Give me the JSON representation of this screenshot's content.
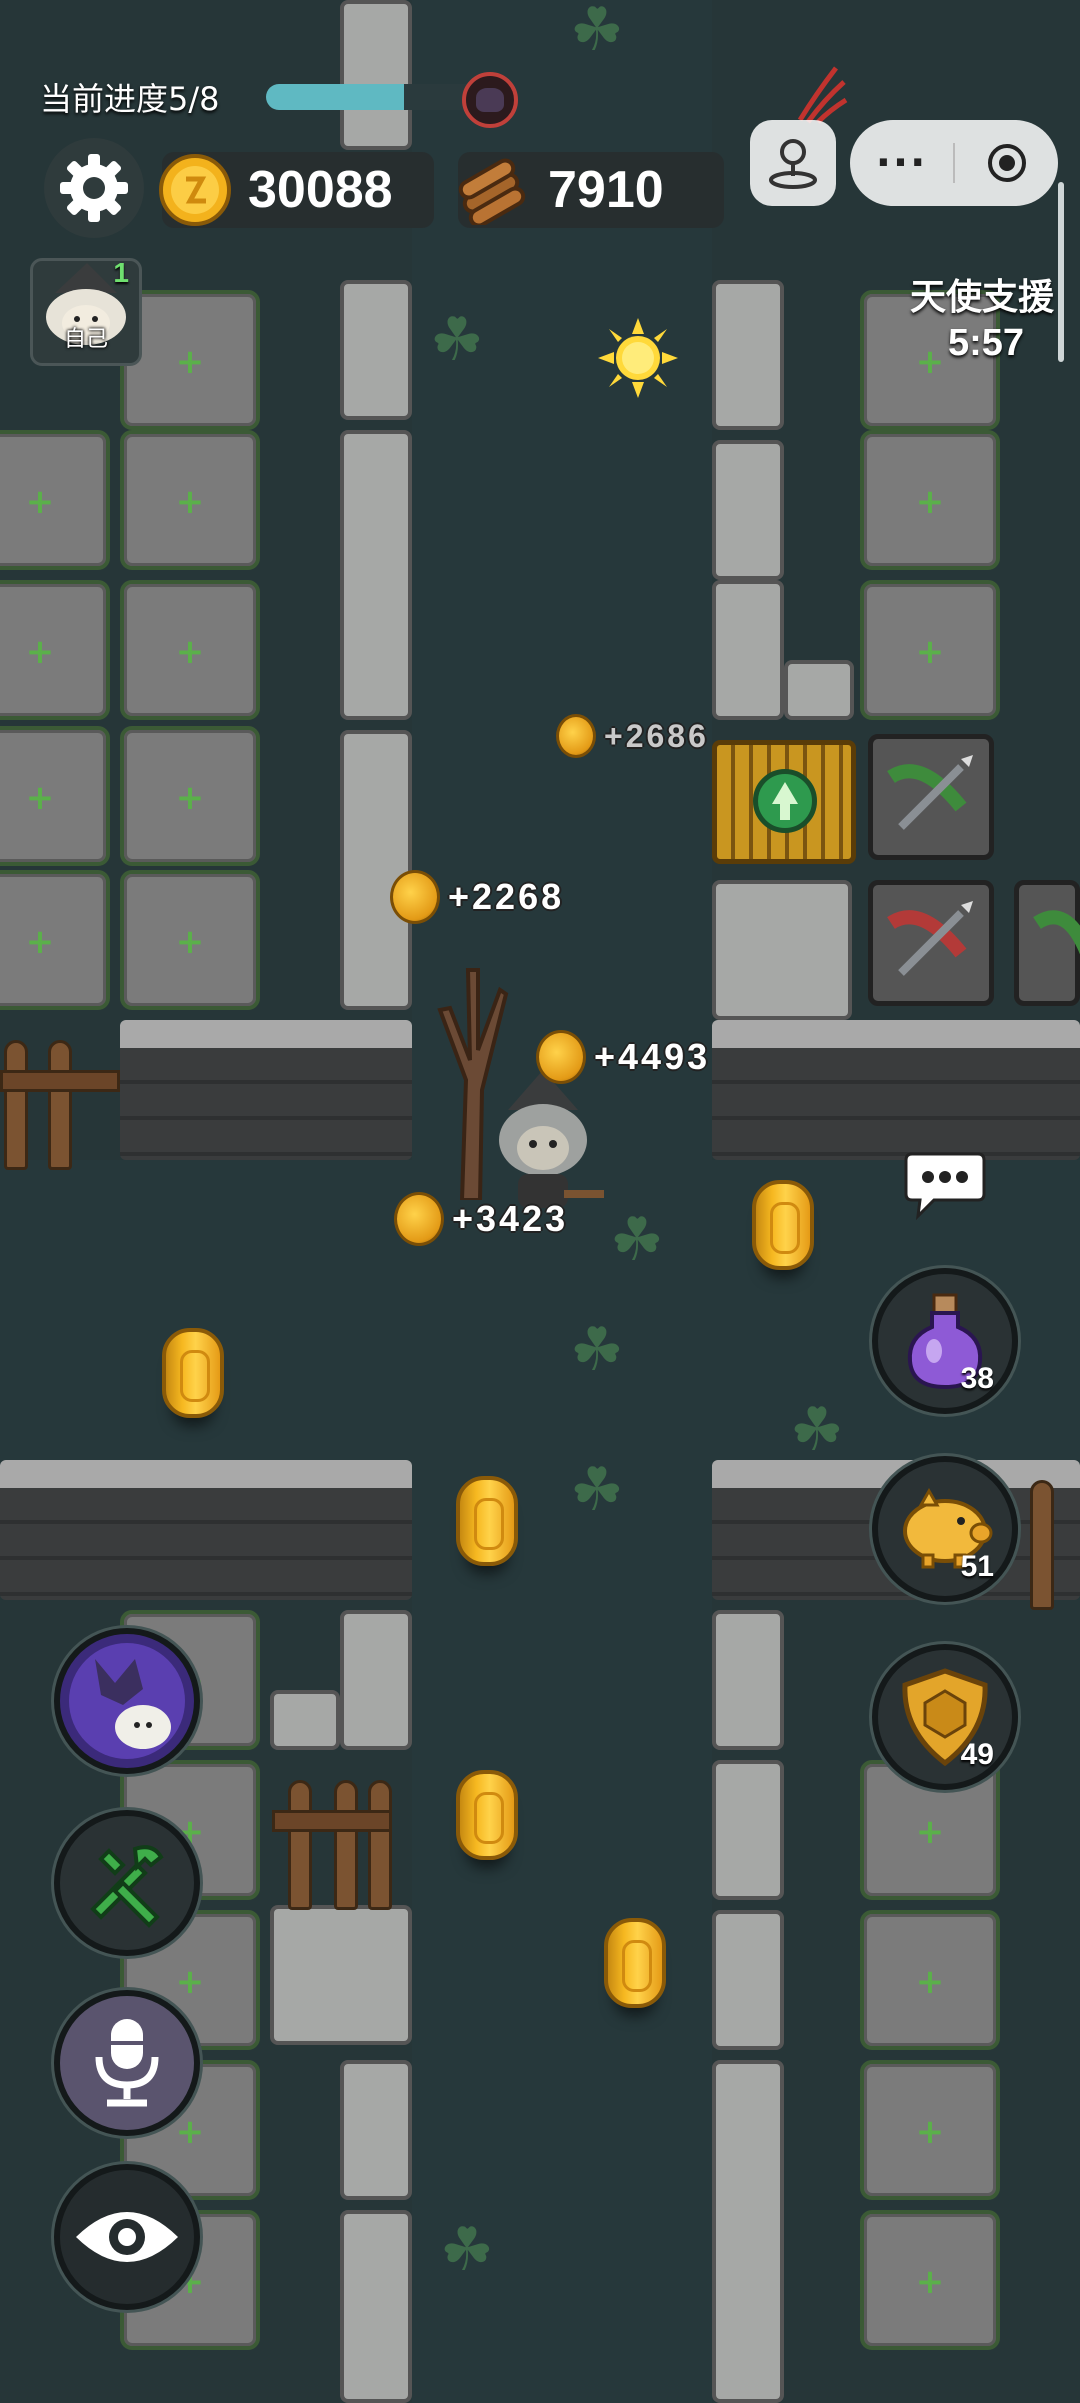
{
  "progress": {
    "label": "当前进度5/8",
    "fraction": 0.625
  },
  "resources": {
    "coins": "30088",
    "wood": "7910"
  },
  "player": {
    "level": "1",
    "name": "自己"
  },
  "angel_support": {
    "title": "天使支援",
    "timer": "5:57"
  },
  "capsule": {
    "more": "···"
  },
  "coin_popups": [
    {
      "text": "+2686"
    },
    {
      "text": "+2268"
    },
    {
      "text": "+4493"
    },
    {
      "text": "+3423"
    }
  ],
  "items": {
    "potion_count": "38",
    "piggy_count": "51",
    "shield_count": "49"
  },
  "colors": {
    "progress_fill": "#5fb9c2",
    "coin": "#f6b820",
    "tile_border": "#3b5a35"
  },
  "icons": {
    "settings": "gear-icon",
    "coin": "coin-icon",
    "wood": "wood-log-icon",
    "potion": "potion-icon",
    "piggy": "piggy-bank-icon",
    "shield": "shield-icon",
    "werewolf": "werewolf-sheep-icon",
    "tools": "tools-icon",
    "mic": "microphone-icon",
    "eye": "eye-icon",
    "chat": "chat-bubble-icon",
    "sun": "sun-icon"
  }
}
